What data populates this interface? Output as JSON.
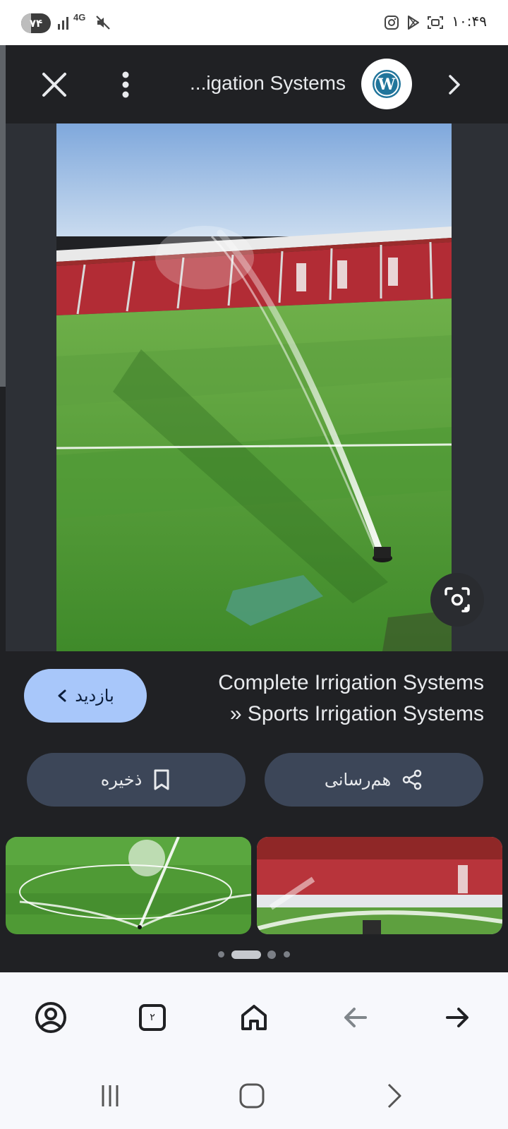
{
  "status_bar": {
    "battery": "۷۴",
    "network": "4G",
    "time": "۱۰:۴۹"
  },
  "viewer": {
    "title": "...igation Systems",
    "source_logo": "wordpress-logo"
  },
  "result": {
    "title_line1": "Complete Irrigation Systems",
    "title_line2": "» Sports Irrigation Systems",
    "visit_label": "بازدید"
  },
  "actions": {
    "share_label": "هم‌رسانی",
    "save_label": "ذخیره"
  },
  "navbar": {
    "tab_count": "۲"
  },
  "colors": {
    "visit_button": "#a8c7fa",
    "action_button": "#3c4658",
    "background": "#202124"
  }
}
